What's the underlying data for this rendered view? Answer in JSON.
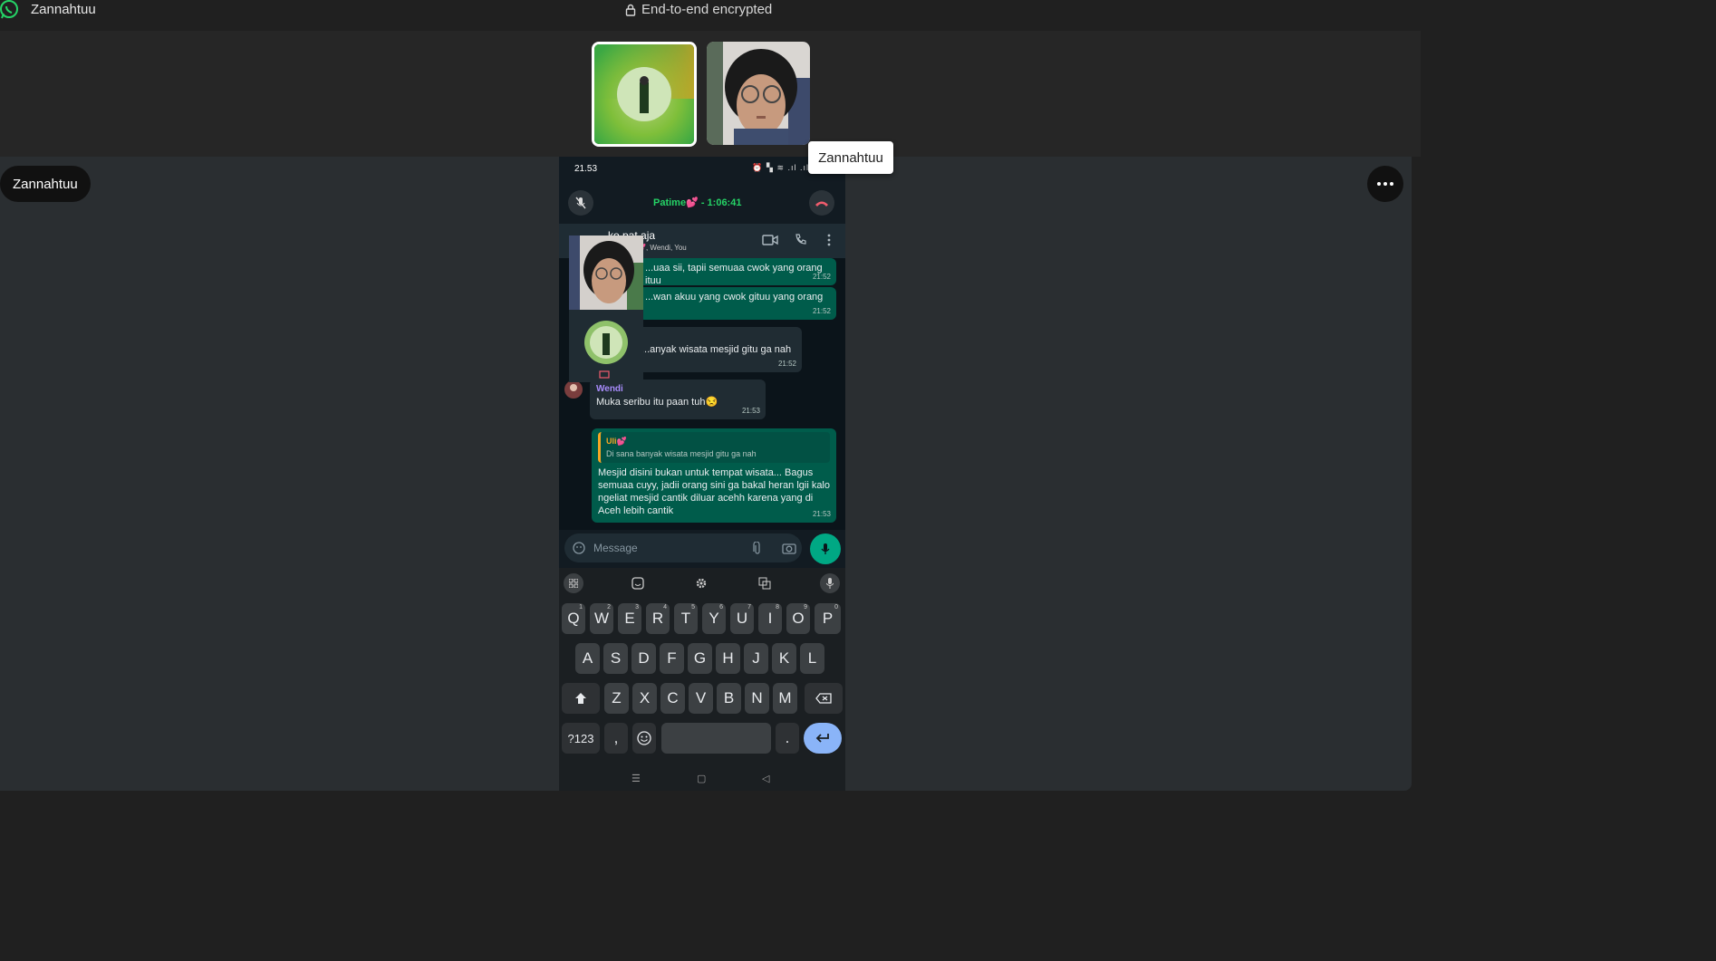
{
  "titlebar": {
    "app_name": "Zannahtuu",
    "encryption_label": "End-to-end encrypted"
  },
  "tooltip": {
    "text": "Zannahtuu"
  },
  "participant": {
    "name": "Zannahtuu"
  },
  "phone": {
    "status_time": "21.53",
    "status_icons": "⏰ ▚ ≋ .ıl .ıl",
    "call_name": "Patime💕 - 1:06:41",
    "chat_title": "ko    pat aja",
    "chat_subtitle": "💕, Wendi, You",
    "messages": [
      {
        "text": "...uaa sii, tapii semuaa cwok yang orang ituu",
        "time": "21:52"
      },
      {
        "text": "...wan akuu yang cwok gituu yang orang",
        "time": "21:52"
      },
      {
        "text": "...anyak wisata mesjid gitu ga nah",
        "time": "21:52"
      },
      {
        "sender": "Wendi",
        "text": "Muka seribu itu paan tuh😒",
        "time": "21:53"
      },
      {
        "quote_name": "Uli💕",
        "quote_text": "Di sana banyak wisata mesjid gitu ga nah",
        "text": "Mesjid disini bukan untuk tempat wisata... Bagus semuaa cuyy, jadii orang sini ga bakal heran lgii kalo ngeliat mesjid cantik diluar acehh karena yang di Aceh lebih cantik",
        "time": "21:53"
      }
    ],
    "input_placeholder": "Message",
    "keyboard": {
      "row1": [
        [
          "Q",
          "1"
        ],
        [
          "W",
          "2"
        ],
        [
          "E",
          "3"
        ],
        [
          "R",
          "4"
        ],
        [
          "T",
          "5"
        ],
        [
          "Y",
          "6"
        ],
        [
          "U",
          "7"
        ],
        [
          "I",
          "8"
        ],
        [
          "O",
          "9"
        ],
        [
          "P",
          "0"
        ]
      ],
      "row2": [
        "A",
        "S",
        "D",
        "F",
        "G",
        "H",
        "J",
        "K",
        "L"
      ],
      "row3": [
        "Z",
        "X",
        "C",
        "V",
        "B",
        "N",
        "M"
      ],
      "sym_label": "?123",
      "comma": ",",
      "period": "."
    }
  },
  "colors": {
    "accent": "#00a884",
    "bubble_out": "#005c4b",
    "bubble_in": "#202c33"
  }
}
